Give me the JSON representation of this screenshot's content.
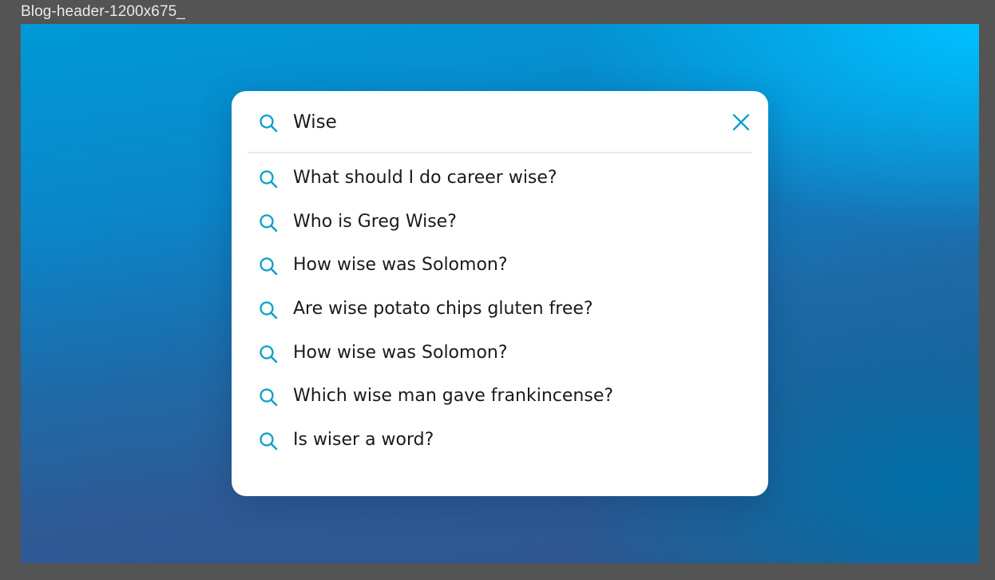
{
  "frame": {
    "label": "Blog-header-1200x675_"
  },
  "search": {
    "query": "Wise",
    "icon": "search-icon",
    "clear_icon": "close-icon"
  },
  "suggestions": [
    {
      "text": "What should I do career wise?"
    },
    {
      "text": "Who is Greg Wise?"
    },
    {
      "text": "How wise was Solomon?"
    },
    {
      "text": "Are wise potato chips gluten free?"
    },
    {
      "text": "How wise was Solomon?"
    },
    {
      "text": "Which wise man gave frankincense?"
    },
    {
      "text": "Is wiser a word?"
    }
  ],
  "colors": {
    "accent": "#0aa0c8",
    "background_top": "#00c0ff",
    "background_bottom": "#2d558c",
    "card": "#ffffff",
    "text": "#1a1a1a"
  }
}
